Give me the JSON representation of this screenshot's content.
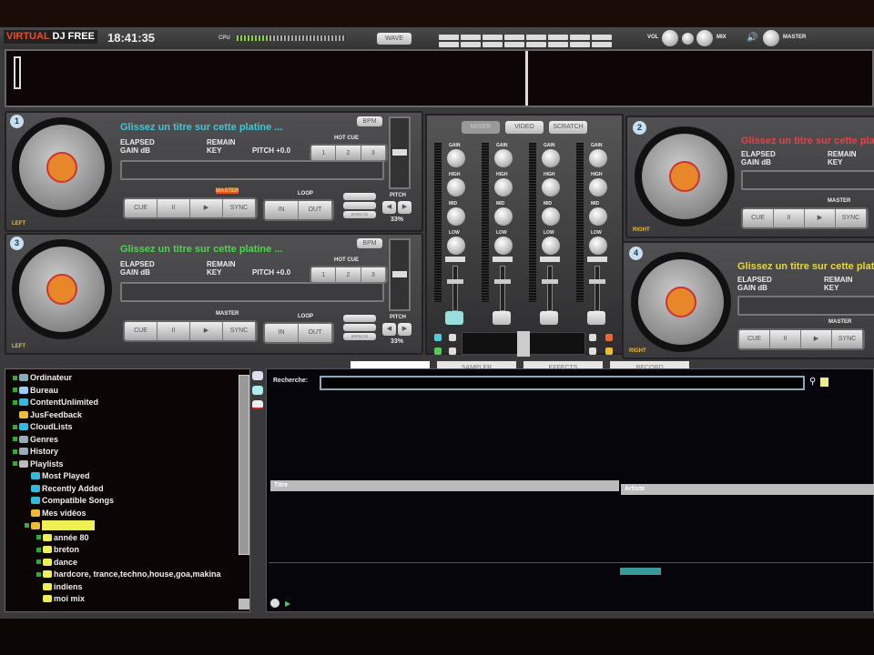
{
  "app": {
    "logo_virtual": "VIRTUAL",
    "logo_dj": "DJ FREE",
    "clock": "18:41:35",
    "cpu_label": "CPU",
    "cpu_load": 0.3,
    "wave_btn": "WAVE",
    "vol_label": "VOL",
    "mix_label": "MIX",
    "master_label": "MASTER",
    "brand_color": "#e8502a"
  },
  "decks": [
    {
      "number": "1",
      "title": "Glissez un titre sur cette platine ...",
      "title_color": "#3cc8d8",
      "side": "LEFT"
    },
    {
      "number": "3",
      "title": "Glissez un titre sur cette platine ...",
      "title_color": "#48d848",
      "side": "LEFT"
    },
    {
      "number": "2",
      "title": "Glissez un titre sur cette platine ...",
      "title_color": "#e84040",
      "side": "RIGHT"
    },
    {
      "number": "4",
      "title": "Glissez un titre sur cette platine ...",
      "title_color": "#e8d830",
      "side": "RIGHT"
    }
  ],
  "deck_labels": {
    "elapsed": "ELAPSED",
    "gain": "GAIN dB",
    "remain": "REMAIN",
    "key": "KEY",
    "pitch_value": "PITCH +0.0",
    "hot_cue": "HOT CUE",
    "hot_cues": [
      "1",
      "2",
      "3"
    ],
    "cue": "CUE",
    "pause": "II",
    "play": "▶",
    "sync": "SYNC",
    "master": "MASTER",
    "loop": "LOOP",
    "loop_in": "IN",
    "loop_out": "OUT",
    "bpm": "BPM",
    "pitch": "PITCH",
    "pitch_range": "33%",
    "effects": "EFFECTS"
  },
  "mixer": {
    "tabs": [
      "MIXER",
      "VIDEO",
      "SCRATCH"
    ],
    "knobs": [
      "GAIN",
      "HIGH",
      "MID",
      "LOW"
    ]
  },
  "tabs": [
    "",
    "SAMPLER",
    "EFFECTS",
    "RECORD"
  ],
  "browser": {
    "search_label": "Recherche:",
    "search_value": "",
    "columns": [
      "Titre",
      "Artiste"
    ]
  },
  "tree": [
    {
      "label": "Ordinateur",
      "color": "#8ab",
      "level": 0,
      "expand": true
    },
    {
      "label": "Bureau",
      "color": "#9cf",
      "level": 0,
      "expand": true
    },
    {
      "label": "ContentUnlimited",
      "color": "#3bd",
      "level": 0,
      "expand": true
    },
    {
      "label": "JusFeedback",
      "color": "#eb3",
      "level": 0,
      "expand": false
    },
    {
      "label": "CloudLists",
      "color": "#3bd",
      "level": 0,
      "expand": true
    },
    {
      "label": "Genres",
      "color": "#9ab",
      "level": 0,
      "expand": true
    },
    {
      "label": "History",
      "color": "#9ab",
      "level": 0,
      "expand": true
    },
    {
      "label": "Playlists",
      "color": "#bbb",
      "level": 0,
      "expand": true
    },
    {
      "label": "Most Played",
      "color": "#3bd",
      "level": 1,
      "expand": false
    },
    {
      "label": "Recently Added",
      "color": "#3bd",
      "level": 1,
      "expand": false
    },
    {
      "label": "Compatible Songs",
      "color": "#3bd",
      "level": 1,
      "expand": false
    },
    {
      "label": "Mes vidéos",
      "color": "#eb3",
      "level": 1,
      "expand": false
    },
    {
      "label": "",
      "color": "#eb3",
      "level": 1,
      "expand": true,
      "selected": true
    },
    {
      "label": "année 80",
      "color": "#ee5",
      "level": 2,
      "expand": true
    },
    {
      "label": "breton",
      "color": "#ee5",
      "level": 2,
      "expand": true
    },
    {
      "label": "dance",
      "color": "#ee5",
      "level": 2,
      "expand": true
    },
    {
      "label": "hardcore, trance,techno,house,goa,makina",
      "color": "#ee5",
      "level": 2,
      "expand": true
    },
    {
      "label": "indiens",
      "color": "#ee5",
      "level": 2,
      "expand": false
    },
    {
      "label": "moi mix",
      "color": "#ee5",
      "level": 2,
      "expand": false
    }
  ]
}
